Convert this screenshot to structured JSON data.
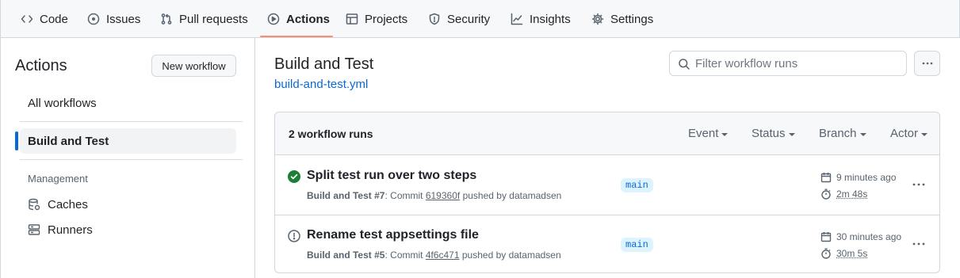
{
  "nav": {
    "items": [
      {
        "label": "Code",
        "icon": "code-icon"
      },
      {
        "label": "Issues",
        "icon": "issue-opened-icon"
      },
      {
        "label": "Pull requests",
        "icon": "git-pull-request-icon"
      },
      {
        "label": "Actions",
        "icon": "play-icon",
        "active": true
      },
      {
        "label": "Projects",
        "icon": "table-icon"
      },
      {
        "label": "Security",
        "icon": "shield-icon"
      },
      {
        "label": "Insights",
        "icon": "graph-icon"
      },
      {
        "label": "Settings",
        "icon": "gear-icon"
      }
    ],
    "active_underline_color": "#fd8c73"
  },
  "sidebar": {
    "title": "Actions",
    "new_workflow_label": "New workflow",
    "all_workflows_label": "All workflows",
    "selected_workflow_label": "Build and Test",
    "management_heading": "Management",
    "caches_label": "Caches",
    "runners_label": "Runners"
  },
  "main": {
    "title": "Build and Test",
    "workflow_file": "build-and-test.yml",
    "filter_placeholder": "Filter workflow runs",
    "runs_count": "2 workflow runs",
    "filters": [
      "Event",
      "Status",
      "Branch",
      "Actor"
    ],
    "runs": [
      {
        "title": "Split test run over two steps",
        "status": "success",
        "workflow": "Build and Test",
        "run_number": "#7",
        "commit_prefix": ": Commit",
        "commit": "619360f",
        "pushed_by": "pushed by datamadsen",
        "branch": "main",
        "time_ago": "9 minutes ago",
        "duration": "2m 48s"
      },
      {
        "title": "Rename test appsettings file",
        "status": "neutral",
        "workflow": "Build and Test",
        "run_number": "#5",
        "commit_prefix": ": Commit",
        "commit": "4f6c471",
        "pushed_by": "pushed by datamadsen",
        "branch": "main",
        "time_ago": "30 minutes ago",
        "duration": "30m 5s"
      }
    ]
  },
  "colors": {
    "accent": "#0969da",
    "success": "#1a7f37",
    "muted": "#59636e"
  }
}
